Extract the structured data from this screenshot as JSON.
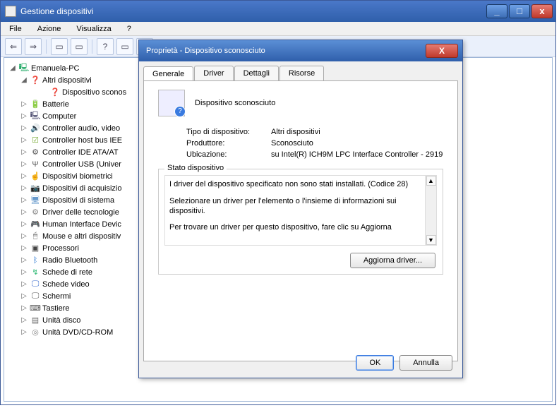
{
  "window": {
    "title": "Gestione dispositivi",
    "menu": {
      "file": "File",
      "azione": "Azione",
      "visualizza": "Visualizza",
      "help": "?"
    },
    "win_btns": {
      "min": "_",
      "max": "□",
      "close": "x"
    }
  },
  "toolbar": {
    "back": "⇐",
    "forward": "⇒",
    "up": "▭",
    "props": "▭",
    "help": "?",
    "refresh": "▭",
    "scan": "▭",
    "sep": ""
  },
  "tree": {
    "root": "Emanuela-PC",
    "items": [
      {
        "label": "Altri dispositivi",
        "expanded": true,
        "iconClass": "ic-warn",
        "glyph": "❓",
        "children": [
          {
            "label": "Dispositivo sconos",
            "iconClass": "ic-warn",
            "glyph": "❓"
          }
        ]
      },
      {
        "label": "Batterie",
        "iconClass": "ic-bat",
        "glyph": "🔋"
      },
      {
        "label": "Computer",
        "iconClass": "ic-comp",
        "glyph": "🖳"
      },
      {
        "label": "Controller audio, video",
        "iconClass": "ic-snd",
        "glyph": "🔊"
      },
      {
        "label": "Controller host bus IEE",
        "iconClass": "ic-hb",
        "glyph": "☑"
      },
      {
        "label": "Controller IDE ATA/AT",
        "iconClass": "ic-ide",
        "glyph": "⚙"
      },
      {
        "label": "Controller USB (Univer",
        "iconClass": "ic-usb",
        "glyph": "Ψ"
      },
      {
        "label": "Dispositivi biometrici",
        "iconClass": "ic-bio",
        "glyph": "☝"
      },
      {
        "label": "Dispositivi di acquisizio",
        "iconClass": "ic-acq",
        "glyph": "📷"
      },
      {
        "label": "Dispositivi di sistema",
        "iconClass": "ic-sys",
        "glyph": "🖥"
      },
      {
        "label": "Driver delle tecnologie",
        "iconClass": "ic-tech",
        "glyph": "⚙"
      },
      {
        "label": "Human Interface Devic",
        "iconClass": "ic-hid",
        "glyph": "🎮"
      },
      {
        "label": "Mouse e altri dispositiv",
        "iconClass": "ic-mouse",
        "glyph": "🖱"
      },
      {
        "label": "Processori",
        "iconClass": "ic-cpu",
        "glyph": "▣"
      },
      {
        "label": "Radio Bluetooth",
        "iconClass": "ic-bt",
        "glyph": "ᛒ"
      },
      {
        "label": "Schede di rete",
        "iconClass": "ic-net",
        "glyph": "↯"
      },
      {
        "label": "Schede video",
        "iconClass": "ic-vid",
        "glyph": "🖵"
      },
      {
        "label": "Schermi",
        "iconClass": "ic-scr",
        "glyph": "🖵"
      },
      {
        "label": "Tastiere",
        "iconClass": "ic-kb",
        "glyph": "⌨"
      },
      {
        "label": "Unità disco",
        "iconClass": "ic-hdd",
        "glyph": "▤"
      },
      {
        "label": "Unità DVD/CD-ROM",
        "iconClass": "ic-dvd",
        "glyph": "◎"
      }
    ]
  },
  "dialog": {
    "title": "Proprietà - Dispositivo sconosciuto",
    "close": "X",
    "tabs": {
      "generale": "Generale",
      "driver": "Driver",
      "dettagli": "Dettagli",
      "risorse": "Risorse"
    },
    "device_name": "Dispositivo sconosciuto",
    "labels": {
      "tipo": "Tipo di dispositivo:",
      "produttore": "Produttore:",
      "ubicazione": "Ubicazione:"
    },
    "values": {
      "tipo": "Altri dispositivi",
      "produttore": "Sconosciuto",
      "ubicazione": "su Intel(R) ICH9M LPC Interface Controller - 2919"
    },
    "groupbox_title": "Stato dispositivo",
    "status_p1": "I driver del dispositivo specificato non sono stati installati. (Codice 28)",
    "status_p2": "Selezionare un driver per l'elemento o l'insieme di informazioni sui dispositivi.",
    "status_p3": "Per trovare un driver per questo dispositivo, fare clic su Aggiorna",
    "update_btn": "Aggiorna driver...",
    "ok": "OK",
    "cancel": "Annulla",
    "scroll_up": "▲",
    "scroll_down": "▼"
  }
}
